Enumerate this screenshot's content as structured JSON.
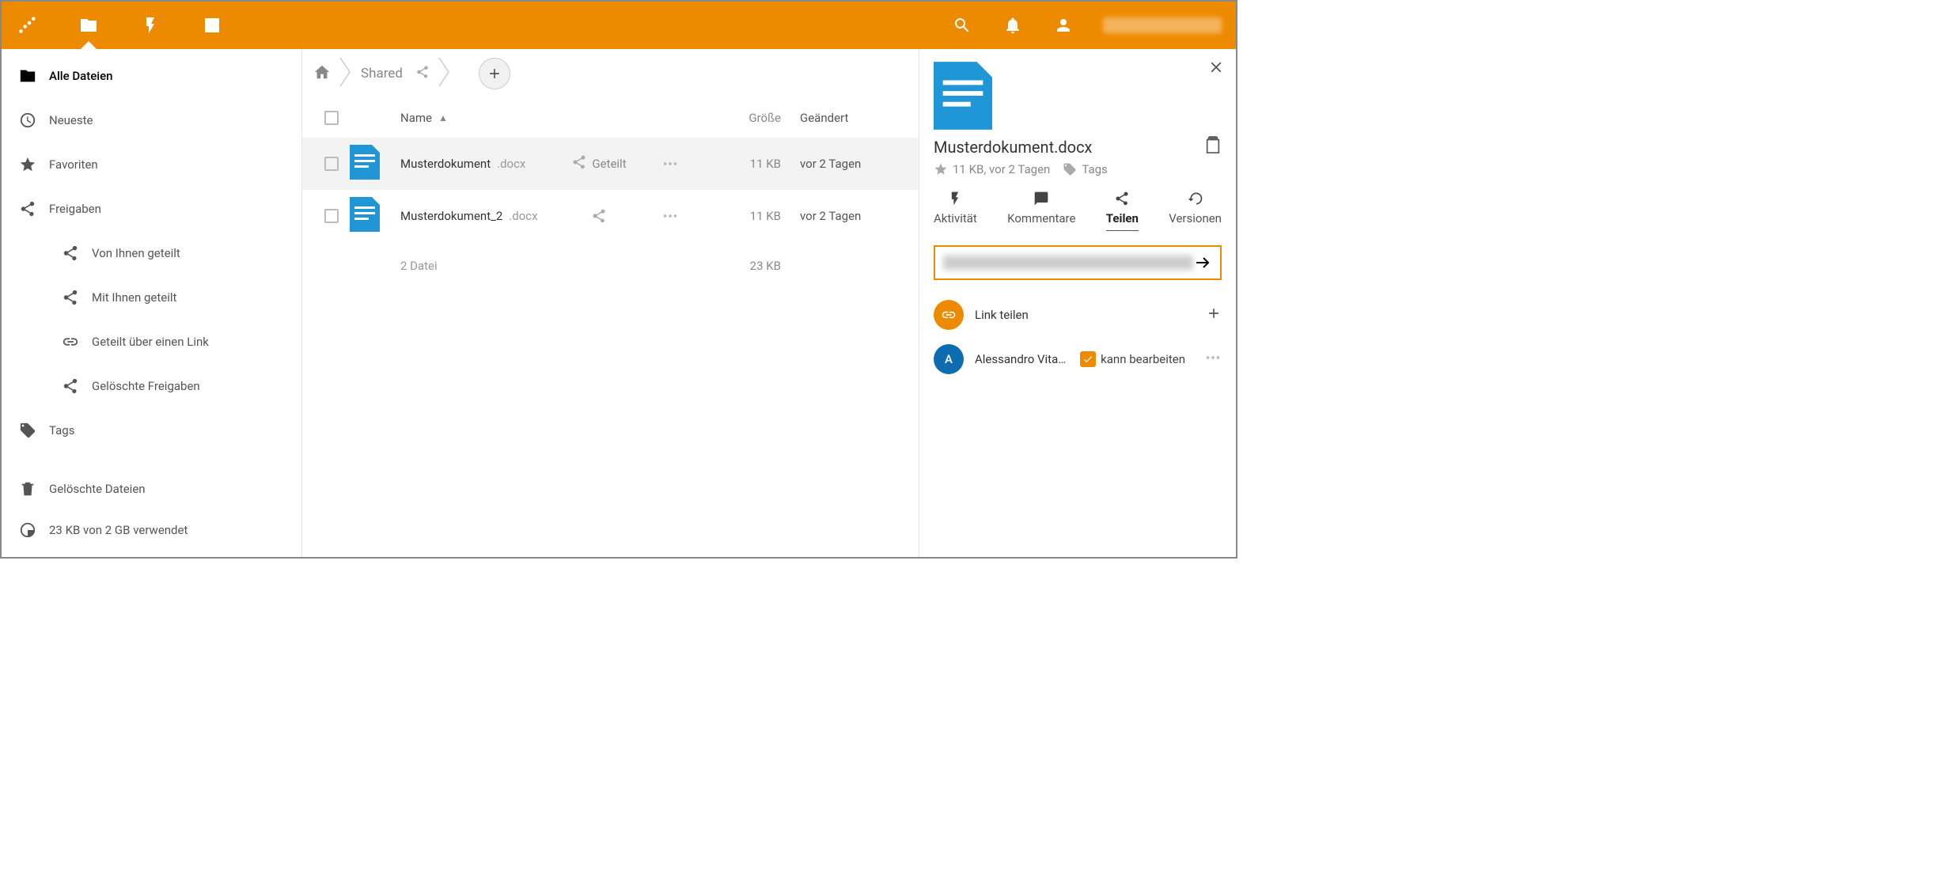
{
  "header": {
    "username": ""
  },
  "sidebar": {
    "items": [
      {
        "label": "Alle Dateien"
      },
      {
        "label": "Neueste"
      },
      {
        "label": "Favoriten"
      },
      {
        "label": "Freigaben"
      },
      {
        "label": "Von Ihnen geteilt"
      },
      {
        "label": "Mit Ihnen geteilt"
      },
      {
        "label": "Geteilt über einen Link"
      },
      {
        "label": "Gelöschte Freigaben"
      },
      {
        "label": "Tags"
      }
    ],
    "trash": "Gelöschte Dateien",
    "quota": "23 KB von 2 GB verwendet"
  },
  "crumbs": {
    "shared": "Shared"
  },
  "columns": {
    "name": "Name",
    "size": "Größe",
    "modified": "Geändert"
  },
  "files": [
    {
      "name": "Musterdokument",
      "ext": ".docx",
      "shared_label": "Geteilt",
      "size": "11 KB",
      "modified": "vor 2 Tagen"
    },
    {
      "name": "Musterdokument_2",
      "ext": ".docx",
      "shared_label": "",
      "size": "11 KB",
      "modified": "vor 2 Tagen"
    }
  ],
  "summary": {
    "count": "2 Datei",
    "size": "23 KB"
  },
  "details": {
    "filename": "Musterdokument.docx",
    "meta": "11 KB, vor 2 Tagen",
    "tags": "Tags",
    "tabs": {
      "activity": "Aktivität",
      "comments": "Kommentare",
      "share": "Teilen",
      "versions": "Versionen"
    },
    "link_share": "Link teilen",
    "sharee": "Alessandro Vita…",
    "can_edit": "kann bearbeiten"
  }
}
